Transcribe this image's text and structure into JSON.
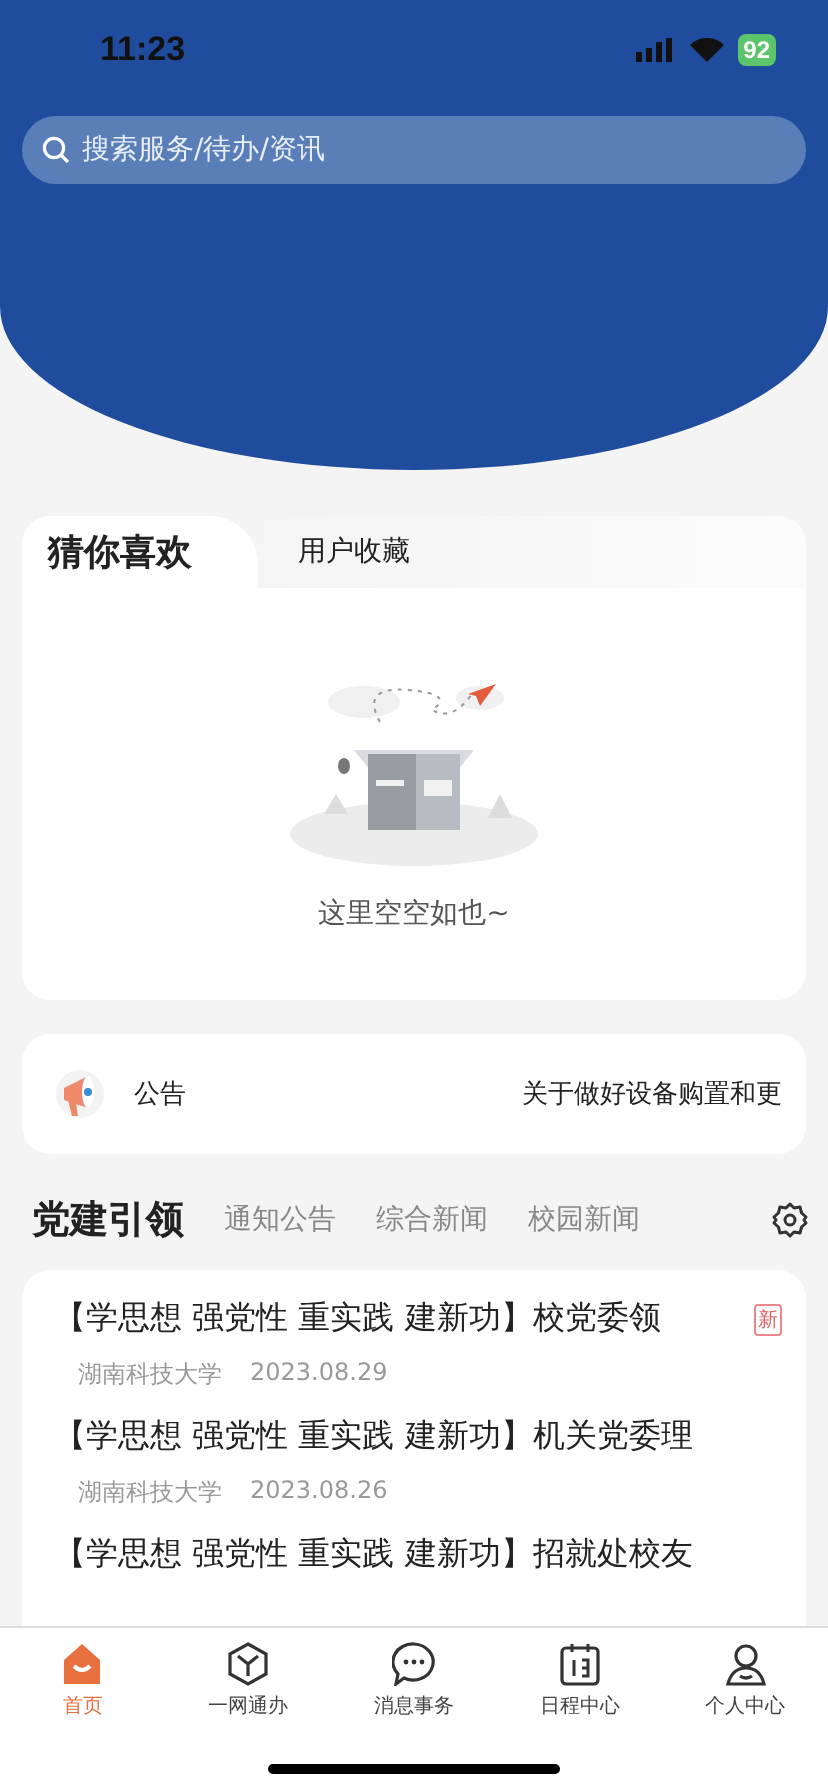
{
  "status_bar": {
    "time": "11:23",
    "battery": "92"
  },
  "search": {
    "placeholder": "搜索服务/待办/资讯"
  },
  "favorites": {
    "tabs": [
      {
        "label": "猜你喜欢",
        "selected": true
      },
      {
        "label": "用户收藏",
        "selected": false
      }
    ],
    "empty_text": "这里空空如也~"
  },
  "notice": {
    "label": "公告",
    "text": "关于做好设备购置和更"
  },
  "news_tabs": [
    {
      "label": "党建引领",
      "selected": true
    },
    {
      "label": "通知公告",
      "selected": false
    },
    {
      "label": "综合新闻",
      "selected": false
    },
    {
      "label": "校园新闻",
      "selected": false
    }
  ],
  "news": [
    {
      "title": "【学思想 强党性 重实践 建新功】校党委领",
      "source": "湖南科技大学",
      "date": "2023.08.29",
      "badge": "新"
    },
    {
      "title": "【学思想 强党性 重实践 建新功】机关党委理",
      "source": "湖南科技大学",
      "date": "2023.08.26"
    },
    {
      "title": "【学思想 强党性 重实践 建新功】招就处校友"
    }
  ],
  "tab_bar": [
    {
      "label": "首页",
      "kind": "home",
      "selected": true
    },
    {
      "label": "一网通办",
      "kind": "cube",
      "selected": false
    },
    {
      "label": "消息事务",
      "kind": "chat",
      "selected": false
    },
    {
      "label": "日程中心",
      "kind": "calendar",
      "selected": false
    },
    {
      "label": "个人中心",
      "kind": "person",
      "selected": false
    }
  ]
}
